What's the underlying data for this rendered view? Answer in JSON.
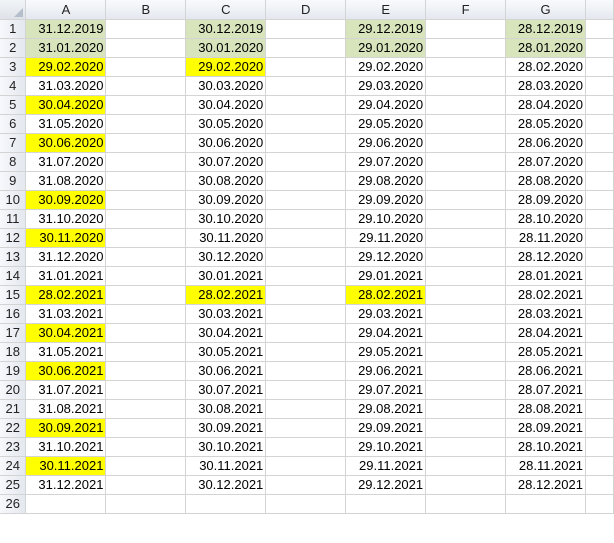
{
  "columns": [
    "A",
    "B",
    "C",
    "D",
    "E",
    "F",
    "G"
  ],
  "rows": [
    {
      "n": "1",
      "cells": [
        "31.12.2019",
        "",
        "30.12.2019",
        "",
        "29.12.2019",
        "",
        "28.12.2019"
      ],
      "fill": [
        "green",
        "",
        "green",
        "",
        "green",
        "",
        "green"
      ]
    },
    {
      "n": "2",
      "cells": [
        "31.01.2020",
        "",
        "30.01.2020",
        "",
        "29.01.2020",
        "",
        "28.01.2020"
      ],
      "fill": [
        "green",
        "",
        "green",
        "",
        "green",
        "",
        "green"
      ]
    },
    {
      "n": "3",
      "cells": [
        "29.02.2020",
        "",
        "29.02.2020",
        "",
        "29.02.2020",
        "",
        "28.02.2020"
      ],
      "fill": [
        "yellow",
        "",
        "yellow",
        "",
        "",
        "",
        ""
      ]
    },
    {
      "n": "4",
      "cells": [
        "31.03.2020",
        "",
        "30.03.2020",
        "",
        "29.03.2020",
        "",
        "28.03.2020"
      ],
      "fill": [
        "",
        "",
        "",
        "",
        "",
        "",
        ""
      ]
    },
    {
      "n": "5",
      "cells": [
        "30.04.2020",
        "",
        "30.04.2020",
        "",
        "29.04.2020",
        "",
        "28.04.2020"
      ],
      "fill": [
        "yellow",
        "",
        "",
        "",
        "",
        "",
        ""
      ]
    },
    {
      "n": "6",
      "cells": [
        "31.05.2020",
        "",
        "30.05.2020",
        "",
        "29.05.2020",
        "",
        "28.05.2020"
      ],
      "fill": [
        "",
        "",
        "",
        "",
        "",
        "",
        ""
      ]
    },
    {
      "n": "7",
      "cells": [
        "30.06.2020",
        "",
        "30.06.2020",
        "",
        "29.06.2020",
        "",
        "28.06.2020"
      ],
      "fill": [
        "yellow",
        "",
        "",
        "",
        "",
        "",
        ""
      ]
    },
    {
      "n": "8",
      "cells": [
        "31.07.2020",
        "",
        "30.07.2020",
        "",
        "29.07.2020",
        "",
        "28.07.2020"
      ],
      "fill": [
        "",
        "",
        "",
        "",
        "",
        "",
        ""
      ]
    },
    {
      "n": "9",
      "cells": [
        "31.08.2020",
        "",
        "30.08.2020",
        "",
        "29.08.2020",
        "",
        "28.08.2020"
      ],
      "fill": [
        "",
        "",
        "",
        "",
        "",
        "",
        ""
      ]
    },
    {
      "n": "10",
      "cells": [
        "30.09.2020",
        "",
        "30.09.2020",
        "",
        "29.09.2020",
        "",
        "28.09.2020"
      ],
      "fill": [
        "yellow",
        "",
        "",
        "",
        "",
        "",
        ""
      ]
    },
    {
      "n": "11",
      "cells": [
        "31.10.2020",
        "",
        "30.10.2020",
        "",
        "29.10.2020",
        "",
        "28.10.2020"
      ],
      "fill": [
        "",
        "",
        "",
        "",
        "",
        "",
        ""
      ]
    },
    {
      "n": "12",
      "cells": [
        "30.11.2020",
        "",
        "30.11.2020",
        "",
        "29.11.2020",
        "",
        "28.11.2020"
      ],
      "fill": [
        "yellow",
        "",
        "",
        "",
        "",
        "",
        ""
      ]
    },
    {
      "n": "13",
      "cells": [
        "31.12.2020",
        "",
        "30.12.2020",
        "",
        "29.12.2020",
        "",
        "28.12.2020"
      ],
      "fill": [
        "",
        "",
        "",
        "",
        "",
        "",
        ""
      ]
    },
    {
      "n": "14",
      "cells": [
        "31.01.2021",
        "",
        "30.01.2021",
        "",
        "29.01.2021",
        "",
        "28.01.2021"
      ],
      "fill": [
        "",
        "",
        "",
        "",
        "",
        "",
        ""
      ]
    },
    {
      "n": "15",
      "cells": [
        "28.02.2021",
        "",
        "28.02.2021",
        "",
        "28.02.2021",
        "",
        "28.02.2021"
      ],
      "fill": [
        "yellow",
        "",
        "yellow",
        "",
        "yellow",
        "",
        ""
      ]
    },
    {
      "n": "16",
      "cells": [
        "31.03.2021",
        "",
        "30.03.2021",
        "",
        "29.03.2021",
        "",
        "28.03.2021"
      ],
      "fill": [
        "",
        "",
        "",
        "",
        "",
        "",
        ""
      ]
    },
    {
      "n": "17",
      "cells": [
        "30.04.2021",
        "",
        "30.04.2021",
        "",
        "29.04.2021",
        "",
        "28.04.2021"
      ],
      "fill": [
        "yellow",
        "",
        "",
        "",
        "",
        "",
        ""
      ]
    },
    {
      "n": "18",
      "cells": [
        "31.05.2021",
        "",
        "30.05.2021",
        "",
        "29.05.2021",
        "",
        "28.05.2021"
      ],
      "fill": [
        "",
        "",
        "",
        "",
        "",
        "",
        ""
      ]
    },
    {
      "n": "19",
      "cells": [
        "30.06.2021",
        "",
        "30.06.2021",
        "",
        "29.06.2021",
        "",
        "28.06.2021"
      ],
      "fill": [
        "yellow",
        "",
        "",
        "",
        "",
        "",
        ""
      ]
    },
    {
      "n": "20",
      "cells": [
        "31.07.2021",
        "",
        "30.07.2021",
        "",
        "29.07.2021",
        "",
        "28.07.2021"
      ],
      "fill": [
        "",
        "",
        "",
        "",
        "",
        "",
        ""
      ]
    },
    {
      "n": "21",
      "cells": [
        "31.08.2021",
        "",
        "30.08.2021",
        "",
        "29.08.2021",
        "",
        "28.08.2021"
      ],
      "fill": [
        "",
        "",
        "",
        "",
        "",
        "",
        ""
      ]
    },
    {
      "n": "22",
      "cells": [
        "30.09.2021",
        "",
        "30.09.2021",
        "",
        "29.09.2021",
        "",
        "28.09.2021"
      ],
      "fill": [
        "yellow",
        "",
        "",
        "",
        "",
        "",
        ""
      ]
    },
    {
      "n": "23",
      "cells": [
        "31.10.2021",
        "",
        "30.10.2021",
        "",
        "29.10.2021",
        "",
        "28.10.2021"
      ],
      "fill": [
        "",
        "",
        "",
        "",
        "",
        "",
        ""
      ]
    },
    {
      "n": "24",
      "cells": [
        "30.11.2021",
        "",
        "30.11.2021",
        "",
        "29.11.2021",
        "",
        "28.11.2021"
      ],
      "fill": [
        "yellow",
        "",
        "",
        "",
        "",
        "",
        ""
      ]
    },
    {
      "n": "25",
      "cells": [
        "31.12.2021",
        "",
        "30.12.2021",
        "",
        "29.12.2021",
        "",
        "28.12.2021"
      ],
      "fill": [
        "",
        "",
        "",
        "",
        "",
        "",
        ""
      ]
    },
    {
      "n": "26",
      "cells": [
        "",
        "",
        "",
        "",
        "",
        "",
        ""
      ],
      "fill": [
        "",
        "",
        "",
        "",
        "",
        "",
        ""
      ]
    }
  ],
  "colors": {
    "green_fill": "#d8e4bc",
    "yellow_fill": "#ffff00",
    "header_border": "#9eb6ce"
  }
}
